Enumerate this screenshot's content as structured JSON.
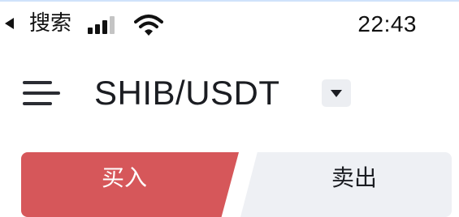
{
  "status_bar": {
    "back_label": "搜索",
    "time": "22:43",
    "icons": [
      "back-arrow-icon",
      "cellular-signal-icon",
      "wifi-icon"
    ]
  },
  "header": {
    "menu_icon": "hamburger-menu-icon",
    "pair": "SHIB/USDT",
    "dropdown_icon": "caret-down-icon"
  },
  "trade_tabs": {
    "buy_label": "买入",
    "sell_label": "卖出",
    "active": "buy",
    "colors": {
      "buy": "#d6575a",
      "sell_bg": "#eef0f4"
    }
  }
}
